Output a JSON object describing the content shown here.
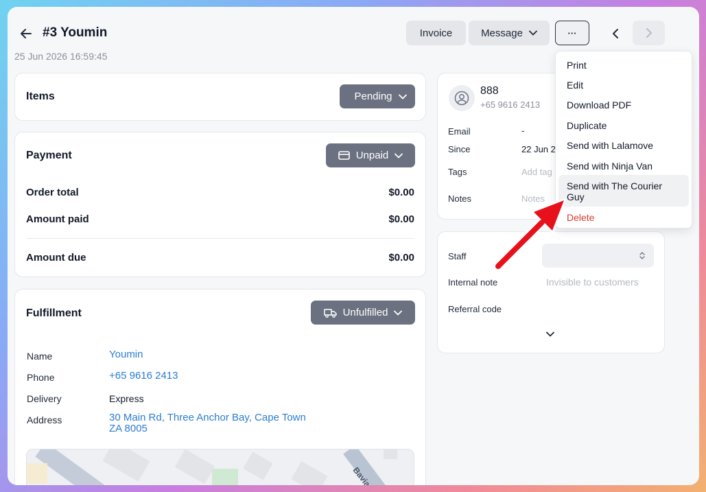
{
  "header": {
    "title": "#3  Youmin",
    "date": "25 Jun 2026 16:59:45",
    "invoice_label": "Invoice",
    "message_label": "Message",
    "more_label": "···"
  },
  "items_card": {
    "title": "Items",
    "status": "Pending"
  },
  "payment_card": {
    "title": "Payment",
    "status": "Unpaid",
    "rows": [
      {
        "label": "Order total",
        "value": "$0.00"
      },
      {
        "label": "Amount paid",
        "value": "$0.00"
      },
      {
        "label": "Amount due",
        "value": "$0.00"
      }
    ]
  },
  "fulfillment_card": {
    "title": "Fulfillment",
    "status": "Unfulfilled",
    "fields": {
      "name_label": "Name",
      "name_value": "Youmin",
      "phone_label": "Phone",
      "phone_value": "+65 9616 2413",
      "delivery_label": "Delivery",
      "delivery_value": "Express",
      "address_label": "Address",
      "address_line1": "30 Main Rd, Three Anchor Bay, Cape Town",
      "address_line2": "ZA 8005"
    },
    "map_street_label": "Bavia"
  },
  "customer_card": {
    "name": "888",
    "phone": "+65 9616 2413",
    "email_label": "Email",
    "email_value": "-",
    "since_label": "Since",
    "since_value": "22 Jun 2",
    "tags_label": "Tags",
    "tags_placeholder": "Add tag",
    "notes_label": "Notes",
    "notes_placeholder": "Notes"
  },
  "staff_card": {
    "staff_label": "Staff",
    "internal_note_label": "Internal note",
    "internal_note_placeholder": "Invisible to customers",
    "referral_label": "Referral code"
  },
  "dropdown_menu": {
    "items": [
      {
        "label": "Print"
      },
      {
        "label": "Edit"
      },
      {
        "label": "Download PDF"
      },
      {
        "label": "Duplicate"
      },
      {
        "label": "Send with Lalamove"
      },
      {
        "label": "Send with Ninja Van"
      },
      {
        "label": "Send with The Courier Guy"
      },
      {
        "label": "Delete"
      }
    ]
  },
  "colors": {
    "accent_link": "#2b7cd3",
    "status_button": "#6b7180",
    "danger": "#d63a2f",
    "annotation_arrow": "#e8101a"
  }
}
